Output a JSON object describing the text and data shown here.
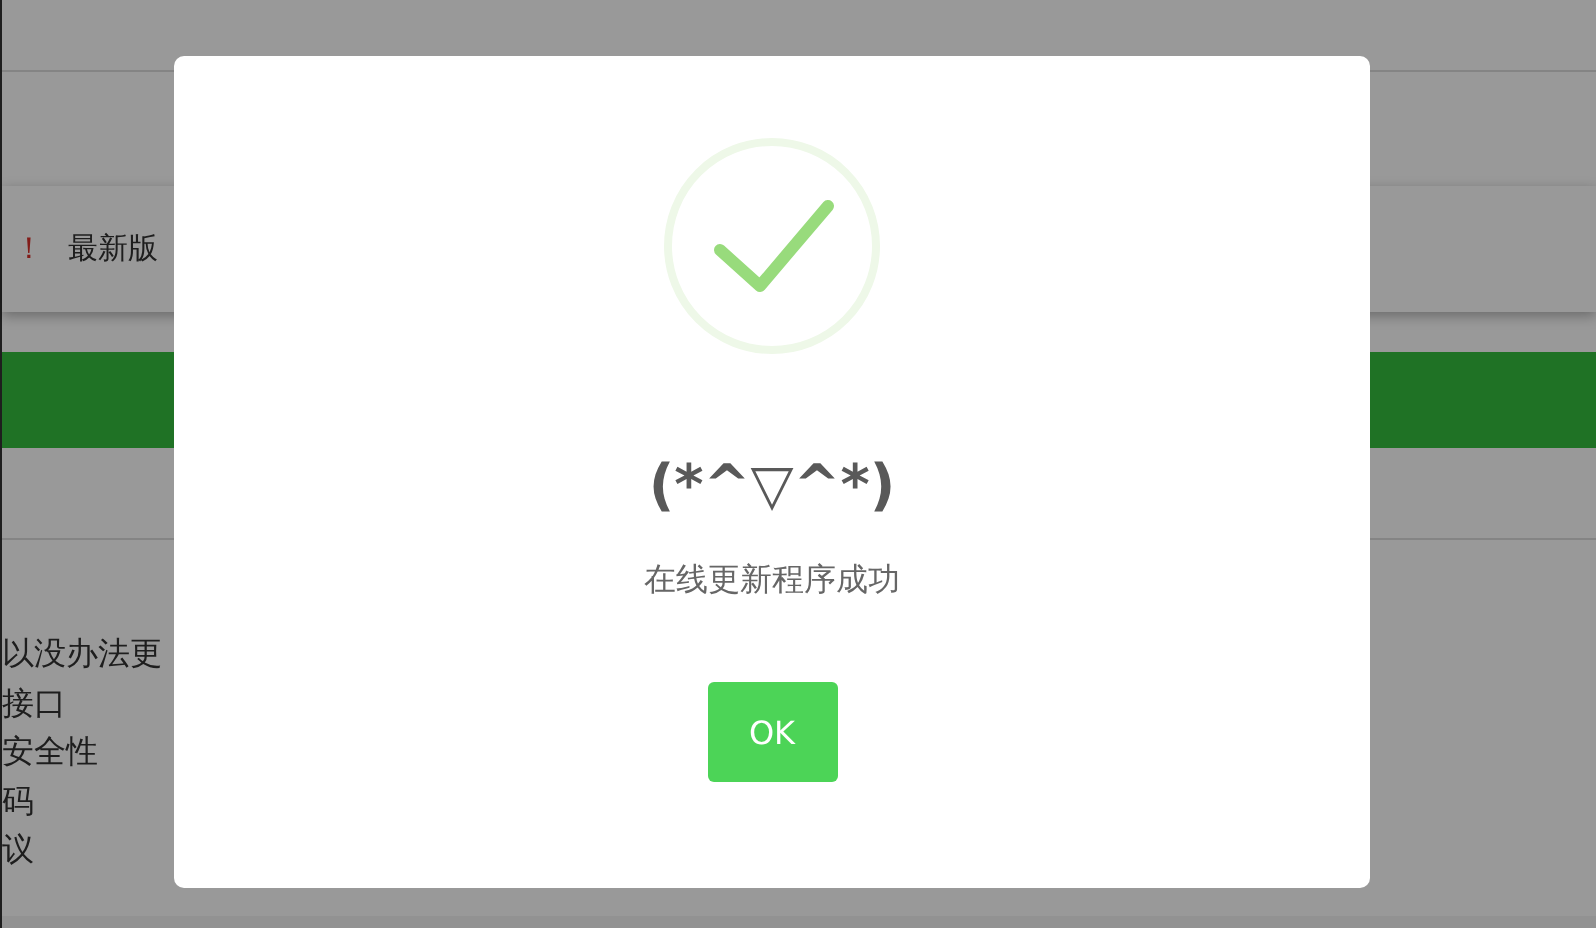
{
  "background_page": {
    "notice": {
      "warning": "！",
      "text": "最新版"
    },
    "lines": [
      "以没办法更",
      "接口",
      "安全性",
      "码",
      "议"
    ]
  },
  "dialog": {
    "title": "(*^▽^*)",
    "message": "在线更新程序成功",
    "button": "OK"
  }
}
